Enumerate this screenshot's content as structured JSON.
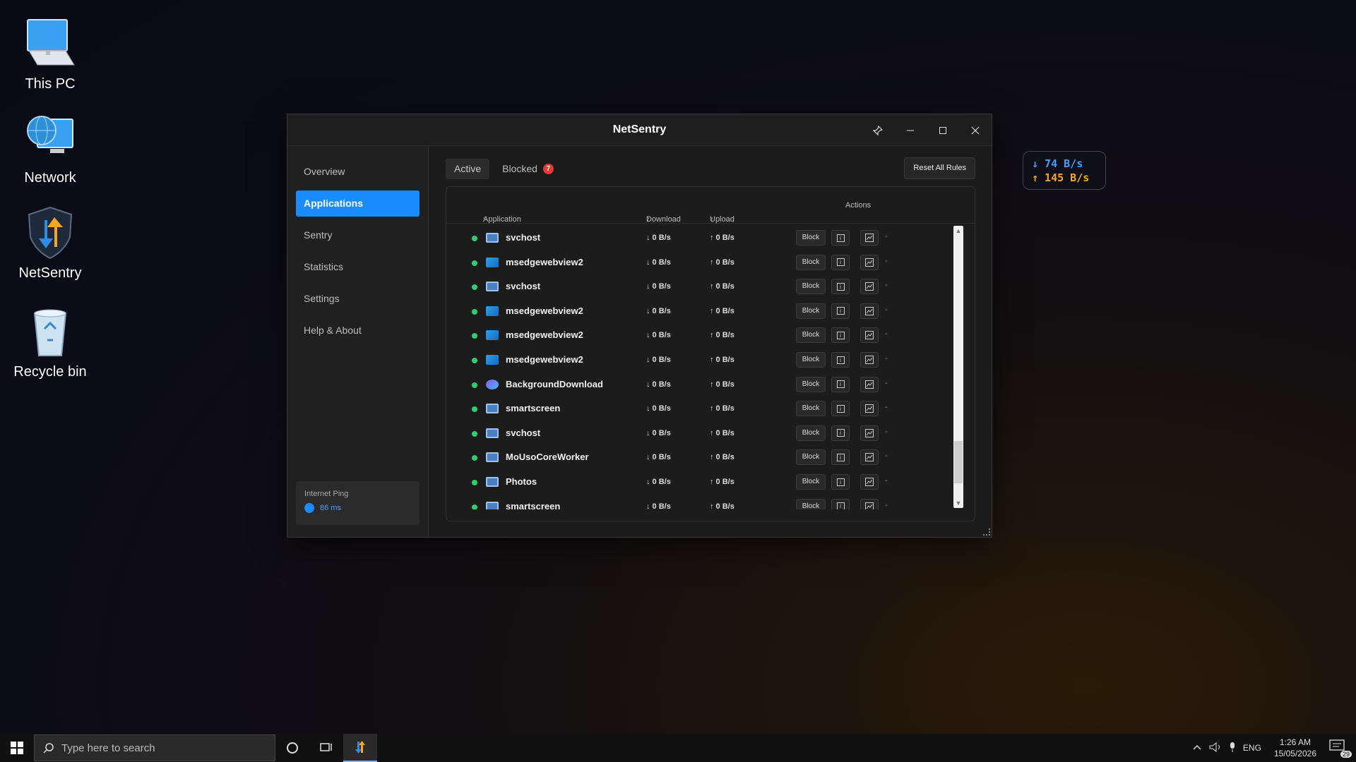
{
  "desktop": {
    "icons": [
      {
        "label": "This PC"
      },
      {
        "label": "Network"
      },
      {
        "label": "NetSentry"
      },
      {
        "label": "Recycle bin"
      }
    ]
  },
  "window": {
    "title": "NetSentry",
    "sidebar": {
      "items": [
        {
          "label": "Overview"
        },
        {
          "label": "Applications"
        },
        {
          "label": "Sentry"
        },
        {
          "label": "Statistics"
        },
        {
          "label": "Settings"
        },
        {
          "label": "Help & About"
        }
      ],
      "active": "Applications",
      "ping": {
        "label": "Internet Ping",
        "value": "86 ms"
      }
    },
    "tabs": {
      "active_label": "Active",
      "blocked_label": "Blocked",
      "blocked_count": "7"
    },
    "reset_label": "Reset All Rules",
    "table": {
      "headers": {
        "application": "Application",
        "download": "Download",
        "upload": "Upload",
        "actions": "Actions"
      },
      "sort_glyph": "▾",
      "download_arrow": "↓",
      "upload_arrow": "↑",
      "block_label": "Block",
      "dash": "-",
      "rows": [
        {
          "name": "svchost",
          "icon": "window-icon",
          "download": "↓ 0 B/s",
          "upload": "↑ 0 B/s"
        },
        {
          "name": "msedgewebview2",
          "icon": "edge-icon",
          "download": "↓ 0 B/s",
          "upload": "↑ 0 B/s"
        },
        {
          "name": "svchost",
          "icon": "window-icon",
          "download": "↓ 0 B/s",
          "upload": "↑ 0 B/s"
        },
        {
          "name": "msedgewebview2",
          "icon": "edge-icon",
          "download": "↓ 0 B/s",
          "upload": "↑ 0 B/s"
        },
        {
          "name": "msedgewebview2",
          "icon": "edge-icon",
          "download": "↓ 0 B/s",
          "upload": "↑ 0 B/s"
        },
        {
          "name": "msedgewebview2",
          "icon": "edge-icon",
          "download": "↓ 0 B/s",
          "upload": "↑ 0 B/s"
        },
        {
          "name": "BackgroundDownload",
          "icon": "background-download-icon",
          "download": "↓ 0 B/s",
          "upload": "↑ 0 B/s"
        },
        {
          "name": "smartscreen",
          "icon": "window-icon",
          "download": "↓ 0 B/s",
          "upload": "↑ 0 B/s"
        },
        {
          "name": "svchost",
          "icon": "window-icon",
          "download": "↓ 0 B/s",
          "upload": "↑ 0 B/s"
        },
        {
          "name": "MoUsoCoreWorker",
          "icon": "window-icon",
          "download": "↓ 0 B/s",
          "upload": "↑ 0 B/s"
        },
        {
          "name": "Photos",
          "icon": "window-icon",
          "download": "↓ 0 B/s",
          "upload": "↑ 0 B/s"
        },
        {
          "name": "smartscreen",
          "icon": "window-icon",
          "download": "↓ 0 B/s",
          "upload": "↑ 0 B/s"
        }
      ]
    }
  },
  "speed_widget": {
    "download": "↓ 74 B/s",
    "upload": "↑ 145 B/s"
  },
  "taskbar": {
    "search_placeholder": "Type here to search",
    "tray": {
      "lang": "ENG",
      "time": "1:26 AM",
      "date": "15/05/2026",
      "notifications": "29"
    }
  },
  "colors": {
    "accent": "#1a8cff",
    "upload": "#f5a623",
    "status_active": "#2ecc71",
    "badge": "#e53935"
  }
}
